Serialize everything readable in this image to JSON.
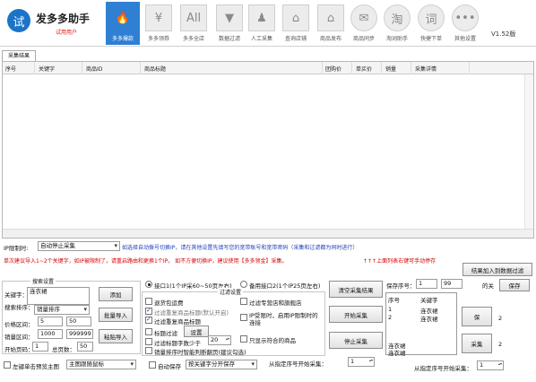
{
  "app": {
    "logo_char": "试",
    "title": "发多多助手",
    "subtitle": "试用用户",
    "version": "V1.52版"
  },
  "nav": [
    {
      "label": "多多爆款",
      "icon": "flame-icon",
      "glyph": "🔥",
      "active": true
    },
    {
      "label": "多多领券",
      "icon": "yen-icon",
      "glyph": "¥"
    },
    {
      "label": "多多全店",
      "icon": "all-icon",
      "glyph": "All"
    },
    {
      "label": "数据过滤",
      "icon": "filter-icon",
      "glyph": "▼"
    },
    {
      "label": "人工采集",
      "icon": "person-icon",
      "glyph": "♟"
    },
    {
      "label": "查询店铺",
      "icon": "store-icon",
      "glyph": "⌂"
    },
    {
      "label": "商品发布",
      "icon": "shop-icon",
      "glyph": "⌂"
    },
    {
      "label": "商品同步",
      "icon": "envelope-icon",
      "glyph": "✉"
    },
    {
      "label": "淘词助手",
      "icon": "tao-icon",
      "glyph": "淘"
    },
    {
      "label": "快捷下单",
      "icon": "word-icon",
      "glyph": "词"
    },
    {
      "label": "其他设置",
      "icon": "more-icon",
      "glyph": "•••"
    }
  ],
  "results_tab": "采集结果",
  "table": {
    "columns": [
      "序号",
      "关键字",
      "商品ID",
      "商品标题",
      "团购价",
      "单买价",
      "销量",
      "采集详情"
    ],
    "rows": []
  },
  "ip_switch": {
    "label": "IP限制时:",
    "value": "自动停止采集",
    "note": "如选择自动拨号切换IP，请在其他设置先填写您的宽带账号和宽带密码（采集和过滤都为同时进行）"
  },
  "warning": {
    "text": "单次建议导入1~2个关键字，如IP被限制了，请重启路由和更换1个IP。 如不方便切换IP，建议使用【多多领金】采集。",
    "arrows": "↑↑↑上面列表右键可手动停存",
    "add_db_button": "结果加入到数据过滤"
  },
  "search_settings": {
    "group_label": "搜索设置",
    "keyword_label": "关键字：",
    "keyword_value": "连衣裙",
    "add_button": "添加",
    "sort_label": "搜索排序：",
    "sort_value": "销量排序",
    "batch_import": "批量导入",
    "price_label": "价格区间：",
    "price_min": "5",
    "price_max": "50",
    "sales_label": "销量区间：",
    "sales_min": "1000",
    "sales_max": "999999",
    "paste_import": "粘贴导入",
    "start_page_label": "开始页码：",
    "start_page": "1",
    "total_pages_label": "总页数：",
    "total_pages": "50"
  },
  "api_options": {
    "option1": "接口1(1个IP采60~50页左右)",
    "option2": "备用接口2(1个IP25页左右)"
  },
  "filter_settings": {
    "group_label": "过滤设置",
    "free_shipping": "退货包运费",
    "filter_repeat_title": "过滤重复商品标题(默认开启)",
    "filter_repeat_item": "过滤重复商品标题",
    "title_filter": "标题过滤",
    "title_filter_button": "设置",
    "title_words_min": "过滤标题字数少于",
    "title_words_value": "20",
    "sales_sort": "销量排序时智能判断翻页(建议勾选)",
    "filter_brand": "过滤专营店和旗舰店",
    "ip_limit_option": "IP受限时，启用IP限制时的连接",
    "keyword_only": "只显示符合的商品"
  },
  "actions": {
    "clear_results": "清空采集结果",
    "start_collect": "开始采集",
    "stop_collect": "停止采集"
  },
  "save": {
    "save_index_label": "保存序号：",
    "save_index_from": "1",
    "save_index_to": "99",
    "save_label_right": "的关",
    "save_button": "保存"
  },
  "keyword_list": {
    "columns": [
      "序号",
      "关键字"
    ],
    "rows": [
      [
        "1",
        "连衣裙"
      ],
      [
        "2",
        "连衣裙"
      ]
    ],
    "extra": [
      "连衣裙",
      "连衣裙"
    ]
  },
  "side_buttons": {
    "btn1": "保",
    "btn1_value": "2",
    "btn2": "采集",
    "btn2_value": "2"
  },
  "bottom": {
    "left_click_label": "左键单击预览主图",
    "main_image_select": "主图跟随鼠标",
    "auto_save": "自动保存",
    "auto_save_mode": "按关键字分开保存",
    "start_from_label": "从指定序号开始采集：",
    "start_from_value": "1",
    "start_from_label2": "从指定序号开始采集：",
    "start_from_value2": "1"
  },
  "colors": {
    "accent": "#2f7fd2",
    "warning": "#d60000",
    "info": "#1a3fb8"
  }
}
